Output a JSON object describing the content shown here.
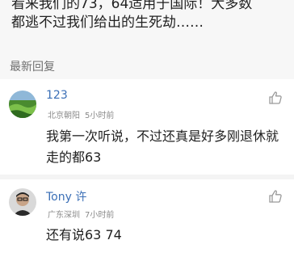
{
  "article": {
    "line1": "看来我们的73，64适用于国际！大多数",
    "line2": "都逃不过我们给出的生死劫……"
  },
  "section": {
    "title": "最新回复"
  },
  "comments": [
    {
      "user": "123",
      "location": "北京朝阳",
      "time": "5小时前",
      "text": "我第一次听说，不过还真是好多刚退休就走的都63",
      "avatar": "landscape-avatar",
      "like_icon": "thumbs-up-icon"
    },
    {
      "user": "Tony 许",
      "location": "广东深圳",
      "time": "7小时前",
      "text": "还有说63 74",
      "avatar": "person-avatar",
      "like_icon": "thumbs-up-icon"
    }
  ],
  "colors": {
    "username": "#3b6fb6",
    "meta": "#8a8a8a",
    "section_bg": "#f7f7f7"
  }
}
